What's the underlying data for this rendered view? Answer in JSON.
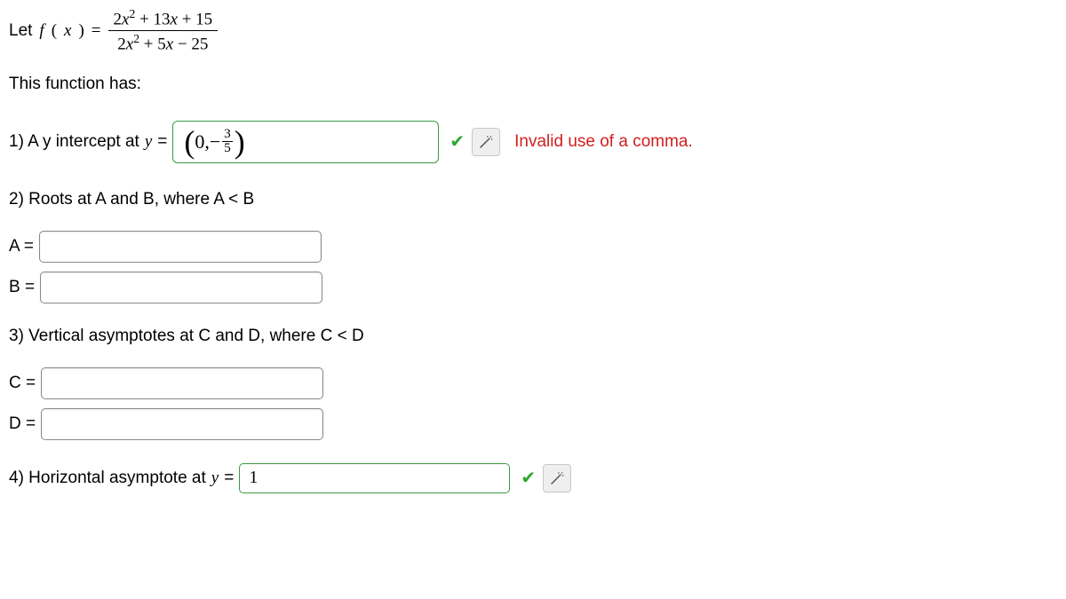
{
  "problem": {
    "prefix": "Let ",
    "fnName": "f",
    "fnArg": "x",
    "eq": " = ",
    "numerator_1": "2",
    "numerator_2": " + 13",
    "numerator_3": " + 15",
    "denominator_1": "2",
    "denominator_2": " + 5",
    "denominator_3": " − 25"
  },
  "intro": "This function has:",
  "q1": {
    "label_pre": "1) A y intercept at ",
    "label_var": "y",
    "label_post": "= ",
    "answer_first": "0",
    "answer_comma": ",",
    "answer_minus": "−",
    "answer_frac_num": "3",
    "answer_frac_den": "5",
    "error": "Invalid use of a comma."
  },
  "q2": {
    "label": "2) Roots at A and B, where A < B",
    "labelA": "A = ",
    "labelB": "B = ",
    "valueA": "",
    "valueB": ""
  },
  "q3": {
    "label": "3) Vertical asymptotes at C and D, where C < D",
    "labelC": "C = ",
    "labelD": "D = ",
    "valueC": "",
    "valueD": ""
  },
  "q4": {
    "label_pre": "4) Horizontal asymptote at ",
    "label_var": "y",
    "label_post": " = ",
    "answer": "1"
  }
}
